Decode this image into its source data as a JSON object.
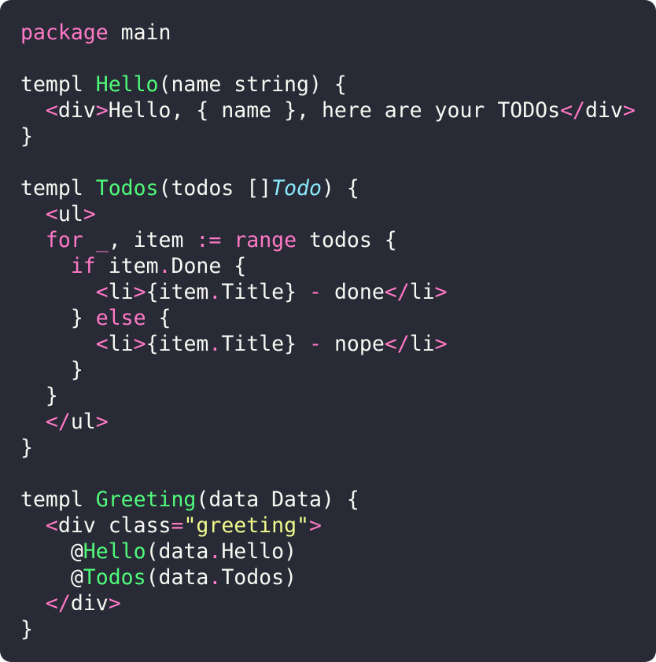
{
  "colors": {
    "background": "#282a36",
    "plain": "#f8f8f2",
    "keyword": "#ff79c6",
    "function": "#50fa7b",
    "type": "#8be9fd",
    "string": "#f1fa8c"
  },
  "code_lines": [
    [
      {
        "t": "kw",
        "v": "package"
      },
      {
        "t": "plain",
        "v": " main"
      }
    ],
    [],
    [
      {
        "t": "plain",
        "v": "templ "
      },
      {
        "t": "fn",
        "v": "Hello"
      },
      {
        "t": "plain",
        "v": "(name string) {"
      }
    ],
    [
      {
        "t": "plain",
        "v": "  "
      },
      {
        "t": "kw",
        "v": "<"
      },
      {
        "t": "plain",
        "v": "div"
      },
      {
        "t": "kw",
        "v": ">"
      },
      {
        "t": "plain",
        "v": "Hello, { name }, here are your TODOs"
      },
      {
        "t": "kw",
        "v": "</"
      },
      {
        "t": "plain",
        "v": "div"
      },
      {
        "t": "kw",
        "v": ">"
      }
    ],
    [
      {
        "t": "plain",
        "v": "}"
      }
    ],
    [],
    [
      {
        "t": "plain",
        "v": "templ "
      },
      {
        "t": "fn",
        "v": "Todos"
      },
      {
        "t": "plain",
        "v": "(todos []"
      },
      {
        "t": "type",
        "v": "Todo"
      },
      {
        "t": "plain",
        "v": ") {"
      }
    ],
    [
      {
        "t": "plain",
        "v": "  "
      },
      {
        "t": "kw",
        "v": "<"
      },
      {
        "t": "plain",
        "v": "ul"
      },
      {
        "t": "kw",
        "v": ">"
      }
    ],
    [
      {
        "t": "plain",
        "v": "  "
      },
      {
        "t": "kw",
        "v": "for"
      },
      {
        "t": "plain",
        "v": " "
      },
      {
        "t": "kw",
        "v": "_"
      },
      {
        "t": "plain",
        "v": ", item "
      },
      {
        "t": "kw",
        "v": ":="
      },
      {
        "t": "plain",
        "v": " "
      },
      {
        "t": "kw",
        "v": "range"
      },
      {
        "t": "plain",
        "v": " todos {"
      }
    ],
    [
      {
        "t": "plain",
        "v": "    "
      },
      {
        "t": "kw",
        "v": "if"
      },
      {
        "t": "plain",
        "v": " item"
      },
      {
        "t": "kw",
        "v": "."
      },
      {
        "t": "plain",
        "v": "Done {"
      }
    ],
    [
      {
        "t": "plain",
        "v": "      "
      },
      {
        "t": "kw",
        "v": "<"
      },
      {
        "t": "plain",
        "v": "li"
      },
      {
        "t": "kw",
        "v": ">"
      },
      {
        "t": "plain",
        "v": "{item"
      },
      {
        "t": "kw",
        "v": "."
      },
      {
        "t": "plain",
        "v": "Title} "
      },
      {
        "t": "kw",
        "v": "-"
      },
      {
        "t": "plain",
        "v": " done"
      },
      {
        "t": "kw",
        "v": "</"
      },
      {
        "t": "plain",
        "v": "li"
      },
      {
        "t": "kw",
        "v": ">"
      }
    ],
    [
      {
        "t": "plain",
        "v": "    } "
      },
      {
        "t": "kw",
        "v": "else"
      },
      {
        "t": "plain",
        "v": " {"
      }
    ],
    [
      {
        "t": "plain",
        "v": "      "
      },
      {
        "t": "kw",
        "v": "<"
      },
      {
        "t": "plain",
        "v": "li"
      },
      {
        "t": "kw",
        "v": ">"
      },
      {
        "t": "plain",
        "v": "{item"
      },
      {
        "t": "kw",
        "v": "."
      },
      {
        "t": "plain",
        "v": "Title} "
      },
      {
        "t": "kw",
        "v": "-"
      },
      {
        "t": "plain",
        "v": " nope"
      },
      {
        "t": "kw",
        "v": "</"
      },
      {
        "t": "plain",
        "v": "li"
      },
      {
        "t": "kw",
        "v": ">"
      }
    ],
    [
      {
        "t": "plain",
        "v": "    }"
      }
    ],
    [
      {
        "t": "plain",
        "v": "  }"
      }
    ],
    [
      {
        "t": "plain",
        "v": "  "
      },
      {
        "t": "kw",
        "v": "</"
      },
      {
        "t": "plain",
        "v": "ul"
      },
      {
        "t": "kw",
        "v": ">"
      }
    ],
    [
      {
        "t": "plain",
        "v": "}"
      }
    ],
    [],
    [
      {
        "t": "plain",
        "v": "templ "
      },
      {
        "t": "fn",
        "v": "Greeting"
      },
      {
        "t": "plain",
        "v": "(data Data) {"
      }
    ],
    [
      {
        "t": "plain",
        "v": "  "
      },
      {
        "t": "kw",
        "v": "<"
      },
      {
        "t": "plain",
        "v": "div class"
      },
      {
        "t": "kw",
        "v": "="
      },
      {
        "t": "str",
        "v": "\"greeting\""
      },
      {
        "t": "kw",
        "v": ">"
      }
    ],
    [
      {
        "t": "plain",
        "v": "    @"
      },
      {
        "t": "fn",
        "v": "Hello"
      },
      {
        "t": "plain",
        "v": "(data"
      },
      {
        "t": "kw",
        "v": "."
      },
      {
        "t": "plain",
        "v": "Hello)"
      }
    ],
    [
      {
        "t": "plain",
        "v": "    @"
      },
      {
        "t": "fn",
        "v": "Todos"
      },
      {
        "t": "plain",
        "v": "(data"
      },
      {
        "t": "kw",
        "v": "."
      },
      {
        "t": "plain",
        "v": "Todos)"
      }
    ],
    [
      {
        "t": "plain",
        "v": "  "
      },
      {
        "t": "kw",
        "v": "</"
      },
      {
        "t": "plain",
        "v": "div"
      },
      {
        "t": "kw",
        "v": ">"
      }
    ],
    [
      {
        "t": "plain",
        "v": "}"
      }
    ]
  ]
}
